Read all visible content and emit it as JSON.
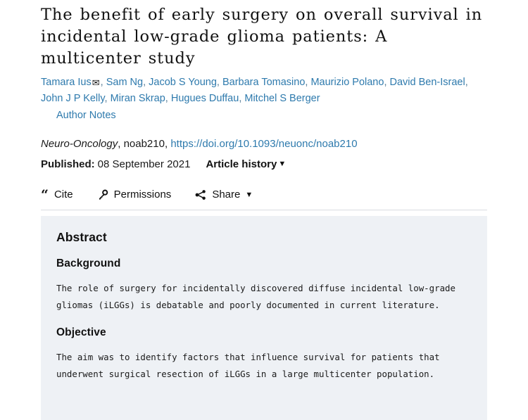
{
  "article": {
    "title": "The benefit of early surgery on overall survival in incidental low-grade glioma patients: A multicenter study",
    "authors": [
      "Tamara Ius",
      "Sam Ng",
      "Jacob S Young",
      "Barbara Tomasino",
      "Maurizio Polano",
      "David Ben-Israel",
      "John J P Kelly",
      "Miran Skrap",
      "Hugues Duffau",
      "Mitchel S Berger"
    ],
    "corresponding_author_icon": "envelope-icon",
    "author_notes_label": "Author Notes",
    "journal": "Neuro-Oncology",
    "article_id": "noab210",
    "doi_url": "https://doi.org/10.1093/neuonc/noab210",
    "published_label": "Published:",
    "published_date": "08 September 2021",
    "article_history_label": "Article history",
    "article_history_caret": "▼"
  },
  "toolbar": {
    "cite_label": "Cite",
    "cite_icon": "quote-icon",
    "permissions_label": "Permissions",
    "permissions_icon": "key-icon",
    "share_label": "Share",
    "share_icon": "share-icon",
    "share_caret": "▼"
  },
  "abstract": {
    "heading": "Abstract",
    "sections": [
      {
        "heading": "Background",
        "text": "The role of surgery for incidentally discovered diffuse incidental low-grade gliomas (iLGGs) is debatable and poorly documented in current literature."
      },
      {
        "heading": "Objective",
        "text": "The aim was to identify factors that influence survival for patients that underwent surgical resection of iLGGs in a large multicenter population."
      }
    ]
  },
  "colors": {
    "link": "#2e7aad",
    "panel_background": "#eef1f5",
    "text": "#1a1a1a",
    "divider": "#d8dce0"
  }
}
